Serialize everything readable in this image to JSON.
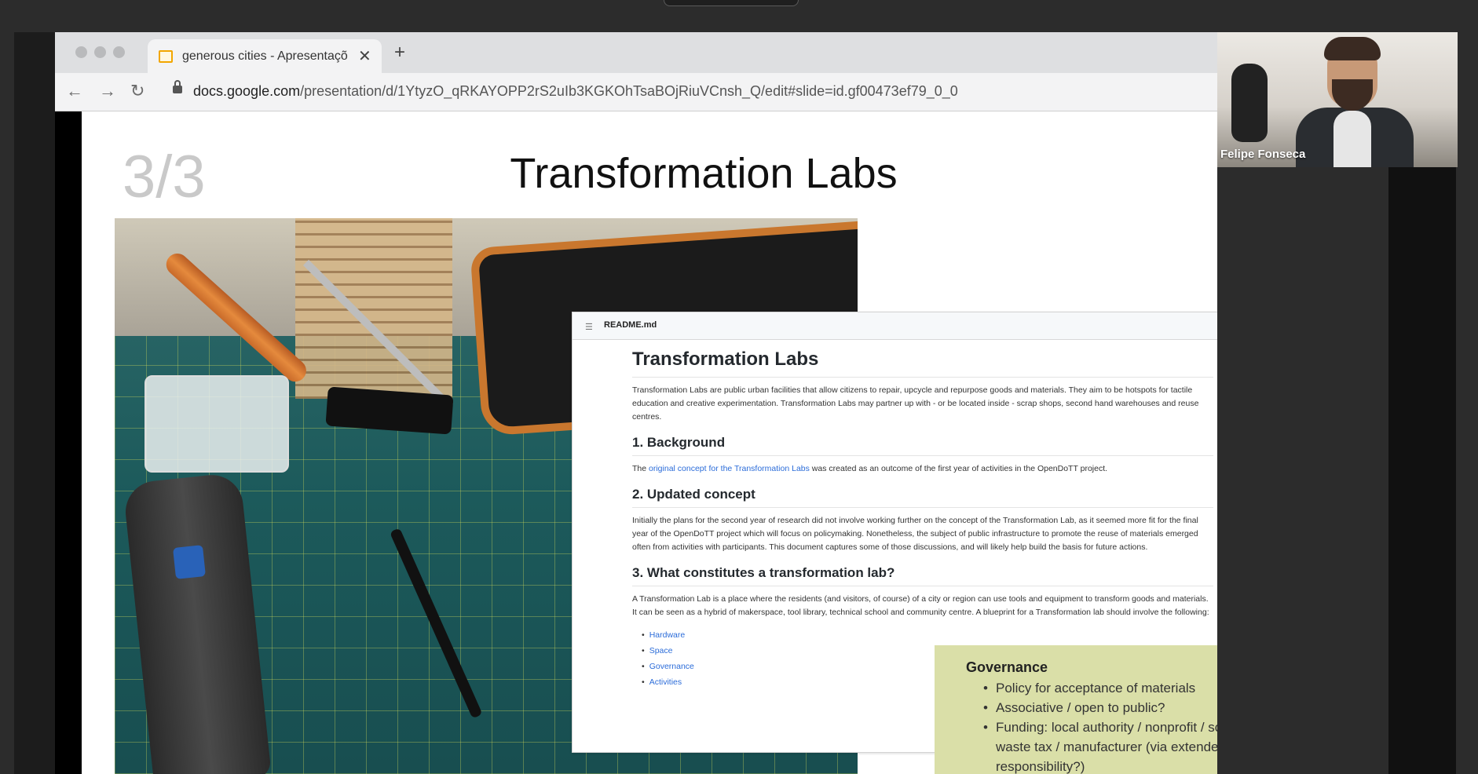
{
  "browser": {
    "tab": {
      "title": "generous cities - Apresentaçõ",
      "close_label": "✕"
    },
    "new_tab_label": "+",
    "address": {
      "host": "docs.google.com",
      "path": "/presentation/d/1YtyzO_qRKAYOPP2rS2uIb3KGKOhTsaBOjRiuVCnsh_Q/edit#slide=id.gf00473ef79_0_0"
    }
  },
  "slide": {
    "number": "3/3",
    "title": "Transformation Labs"
  },
  "readme": {
    "filename": "README.md",
    "heading": "Transformation Labs",
    "intro": "Transformation Labs are public urban facilities that allow citizens to repair, upcycle and repurpose goods and materials. They aim to be hotspots for tactile education and creative experimentation. Transformation Labs may partner up with - or be located inside - scrap shops, second hand warehouses and reuse centres.",
    "sections": [
      {
        "heading": "1. Background",
        "text_before": "The ",
        "link": "original concept for the Transformation Labs",
        "text_after": " was created as an outcome of the first year of activities in the OpenDoTT project."
      },
      {
        "heading": "2. Updated concept",
        "text": "Initially the plans for the second year of research did not involve working further on the concept of the Transformation Lab, as it seemed more fit for the final year of the OpenDoTT project which will focus on policymaking. Nonetheless, the subject of public infrastructure to promote the reuse of materials emerged often from activities with participants. This document captures some of those discussions, and will likely help build the basis for future actions."
      },
      {
        "heading": "3. What constitutes a transformation lab?",
        "text": "A Transformation Lab is a place where the residents (and visitors, of course) of a city or region can use tools and equipment to transform goods and materials. It can be seen as a hybrid of makerspace, tool library, technical school and community centre. A blueprint for a Transformation lab should involve the following:",
        "links": [
          "Hardware",
          "Space",
          "Governance",
          "Activities"
        ]
      }
    ]
  },
  "governance": {
    "title": "Governance",
    "items": [
      "Policy for acceptance of materials",
      "Associative / open to public?",
      "Funding: local authority / nonprofit / social enterprise / waste tax / manufacturer (via extended producer responsibility?)"
    ]
  },
  "presenter": {
    "name": "Felipe Fonseca"
  },
  "icons": {
    "back": "back-arrow-icon",
    "forward": "forward-arrow-icon",
    "reload": "reload-icon",
    "lock": "lock-icon",
    "favicon": "google-slides-icon",
    "readme_list": "list-icon",
    "edit": "pencil-icon"
  }
}
